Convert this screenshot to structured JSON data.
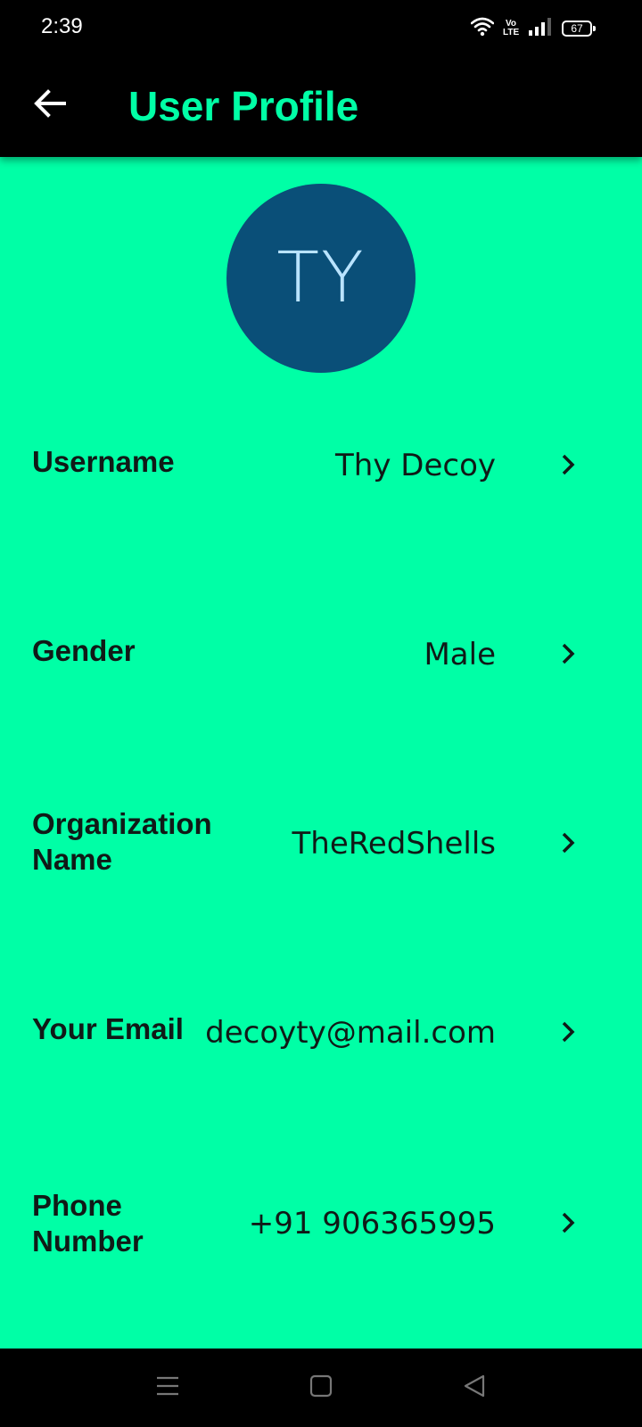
{
  "status_bar": {
    "time": "2:39",
    "volte_top": "Vo",
    "volte_bottom": "LTE",
    "battery": "67",
    "icons": [
      "wifi-icon",
      "volte-icon",
      "signal-icon",
      "battery-icon"
    ]
  },
  "app_bar": {
    "title": "User Profile",
    "back_icon": "arrow-left-icon"
  },
  "profile": {
    "avatar_initials": "TY",
    "fields": [
      {
        "label": "Username",
        "value": "Thy Decoy"
      },
      {
        "label": "Gender",
        "value": "Male"
      },
      {
        "label": "Organization Name",
        "value": "TheRedShells"
      },
      {
        "label": "Your Email",
        "value": "decoyty@mail.com"
      },
      {
        "label": "Phone Number",
        "value": "+91 906365995"
      }
    ]
  },
  "nav_bar": {
    "icons": [
      "menu-icon",
      "home-icon",
      "back-triangle-icon"
    ]
  },
  "colors": {
    "background": "#00ffa6",
    "app_bar": "#000000",
    "title": "#00ffa6",
    "avatar_bg": "#0a4f78",
    "avatar_text": "#b9e3ff",
    "text": "#101a17"
  }
}
